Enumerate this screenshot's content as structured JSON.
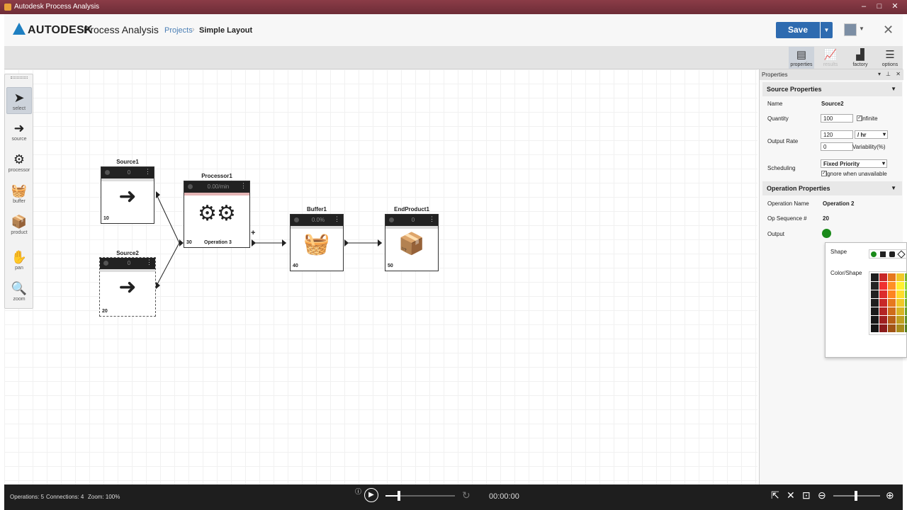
{
  "window": {
    "title": "Autodesk Process Analysis"
  },
  "header": {
    "brand": "AUTODESK",
    "app_name": "Process Analysis",
    "breadcrumb": [
      {
        "label": "Projects"
      },
      {
        "label": "Simple Layout"
      }
    ],
    "save_label": "Save"
  },
  "ribbon": {
    "buttons": [
      {
        "label": "properties",
        "icon": "document-icon",
        "active": true
      },
      {
        "label": "results",
        "icon": "chart-icon",
        "disabled": true
      },
      {
        "label": "factory",
        "icon": "factory-icon"
      },
      {
        "label": "options",
        "icon": "menu-icon"
      }
    ]
  },
  "toolbox": {
    "items": [
      {
        "label": "select",
        "icon": "cursor-icon",
        "active": true
      },
      {
        "label": "source",
        "icon": "arrow-icon"
      },
      {
        "label": "processor",
        "icon": "gears-icon"
      },
      {
        "label": "buffer",
        "icon": "basket-icon"
      },
      {
        "label": "product",
        "icon": "box-icon"
      },
      {
        "label": "pan",
        "icon": "hand-icon"
      },
      {
        "label": "zoom",
        "icon": "zoom-icon"
      }
    ]
  },
  "canvas": {
    "nodes": [
      {
        "name": "Source1",
        "value": "0",
        "seq": "10"
      },
      {
        "name": "Source2",
        "value": "0",
        "seq": "20"
      },
      {
        "name": "Processor1",
        "value": "0.00/min",
        "seq": "30",
        "op_name": "Operation 3"
      },
      {
        "name": "Buffer1",
        "value": "0.0%",
        "seq": "40"
      },
      {
        "name": "EndProduct1",
        "value": "0",
        "seq": "50"
      }
    ]
  },
  "properties": {
    "panel_title": "Properties",
    "source_section": "Source Properties",
    "name_label": "Name",
    "name_value": "Source2",
    "quantity_label": "Quantity",
    "quantity_value": "100",
    "infinite_label": "Infinite",
    "infinite_checked": true,
    "output_rate_label": "Output Rate",
    "output_rate_value": "120",
    "output_rate_unit": "/ hr",
    "variability_value": "0",
    "variability_label": "Variability(%)",
    "scheduling_label": "Scheduling",
    "scheduling_value": "Fixed Priority",
    "ignore_label": "Ignore when unavailable",
    "ignore_checked": true,
    "operation_section": "Operation Properties",
    "op_name_label": "Operation Name",
    "op_name_value": "Operation 2",
    "op_seq_label": "Op Sequence #",
    "op_seq_value": "20",
    "output_label": "Output",
    "output_color": "#1a8a1a"
  },
  "popup": {
    "shape_label": "Shape",
    "color_label": "Color/Shape"
  },
  "status": {
    "operations": "Operations: 5",
    "connections": "Connections: 4",
    "zoom": "Zoom: 100%",
    "time": "00:00:00"
  }
}
